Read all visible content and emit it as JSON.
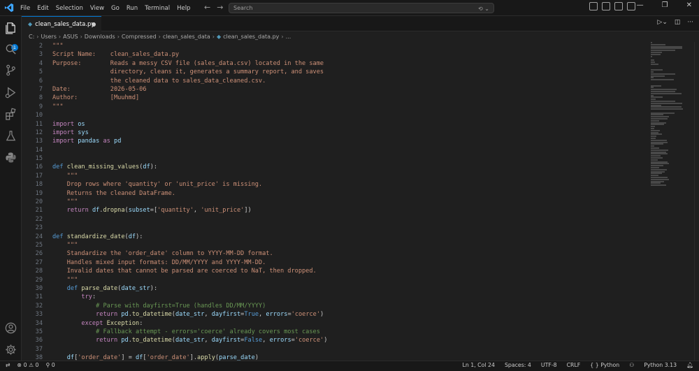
{
  "menu": [
    "File",
    "Edit",
    "Selection",
    "View",
    "Go",
    "Run",
    "Terminal",
    "Help"
  ],
  "search": {
    "placeholder": "Search"
  },
  "activity": {
    "badge": "1"
  },
  "tab": {
    "label": "clean_sales_data.py"
  },
  "breadcrumb": [
    "C:",
    "Users",
    "ASUS",
    "Downloads",
    "Compressed",
    "clean_sales_data",
    "clean_sales_data.py",
    "..."
  ],
  "code": [
    {
      "n": "2",
      "html": "<span class=\"doc\">\"\"\"</span>"
    },
    {
      "n": "3",
      "html": "<span class=\"doc\">Script Name:    clean_sales_data.py</span>"
    },
    {
      "n": "4",
      "html": "<span class=\"doc\">Purpose:        Reads a messy CSV file (sales_data.csv) located in the same</span>"
    },
    {
      "n": "5",
      "html": "<span class=\"doc\">                directory, cleans it, generates a summary report, and saves</span>"
    },
    {
      "n": "6",
      "html": "<span class=\"doc\">                the cleaned data to sales_data_cleaned.csv.</span>"
    },
    {
      "n": "7",
      "html": "<span class=\"doc\">Date:           2026-05-06</span>"
    },
    {
      "n": "8",
      "html": "<span class=\"doc\">Author:         [Muuhmd]</span>"
    },
    {
      "n": "9",
      "html": "<span class=\"doc\">\"\"\"</span>"
    },
    {
      "n": "10",
      "html": ""
    },
    {
      "n": "11",
      "html": "<span class=\"kw2\">import</span> <span class=\"prm\">os</span>"
    },
    {
      "n": "12",
      "html": "<span class=\"kw2\">import</span> <span class=\"prm\">sys</span>"
    },
    {
      "n": "13",
      "html": "<span class=\"kw2\">import</span> <span class=\"prm\">pandas</span> <span class=\"kw2\">as</span> <span class=\"prm\">pd</span>"
    },
    {
      "n": "14",
      "html": ""
    },
    {
      "n": "15",
      "html": ""
    },
    {
      "n": "16",
      "html": "<span class=\"kw\">def</span> <span class=\"fn\">clean_missing_values</span>(<span class=\"prm\">df</span>):"
    },
    {
      "n": "17",
      "html": "    <span class=\"doc\">\"\"\"</span>"
    },
    {
      "n": "18",
      "html": "    <span class=\"doc\">Drop rows where 'quantity' or 'unit_price' is missing.</span>"
    },
    {
      "n": "19",
      "html": "    <span class=\"doc\">Returns the cleaned DataFrame.</span>"
    },
    {
      "n": "20",
      "html": "    <span class=\"doc\">\"\"\"</span>"
    },
    {
      "n": "21",
      "html": "    <span class=\"kw2\">return</span> <span class=\"prm\">df</span>.<span class=\"fn\">dropna</span>(<span class=\"prm\">subset</span>=[<span class=\"str\">'quantity'</span>, <span class=\"str\">'unit_price'</span>])"
    },
    {
      "n": "22",
      "html": ""
    },
    {
      "n": "23",
      "html": ""
    },
    {
      "n": "24",
      "html": "<span class=\"kw\">def</span> <span class=\"fn\">standardize_date</span>(<span class=\"prm\">df</span>):"
    },
    {
      "n": "25",
      "html": "    <span class=\"doc\">\"\"\"</span>"
    },
    {
      "n": "26",
      "html": "    <span class=\"doc\">Standardize the 'order_date' column to YYYY-MM-DD format.</span>"
    },
    {
      "n": "27",
      "html": "    <span class=\"doc\">Handles mixed input formats: DD/MM/YYYY and YYYY-MM-DD.</span>"
    },
    {
      "n": "28",
      "html": "    <span class=\"doc\">Invalid dates that cannot be parsed are coerced to NaT, then dropped.</span>"
    },
    {
      "n": "29",
      "html": "    <span class=\"doc\">\"\"\"</span>"
    },
    {
      "n": "30",
      "html": "    <span class=\"kw\">def</span> <span class=\"fn\">parse_date</span>(<span class=\"prm\">date_str</span>):"
    },
    {
      "n": "31",
      "html": "        <span class=\"kw2\">try</span>:"
    },
    {
      "n": "32",
      "html": "            <span class=\"cm\"># Parse with dayfirst=True (handles DD/MM/YYYY)</span>"
    },
    {
      "n": "33",
      "html": "            <span class=\"kw2\">return</span> <span class=\"prm\">pd</span>.<span class=\"fn\">to_datetime</span>(<span class=\"prm\">date_str</span>, <span class=\"prm\">dayfirst</span>=<span class=\"kw\">True</span>, <span class=\"prm\">errors</span>=<span class=\"str\">'coerce'</span>)"
    },
    {
      "n": "34",
      "html": "        <span class=\"kw2\">except</span> <span class=\"fn\">Exception</span>:"
    },
    {
      "n": "35",
      "html": "            <span class=\"cm\"># Fallback attempt - errors='coerce' already covers most cases</span>"
    },
    {
      "n": "36",
      "html": "            <span class=\"kw2\">return</span> <span class=\"prm\">pd</span>.<span class=\"fn\">to_datetime</span>(<span class=\"prm\">date_str</span>, <span class=\"prm\">dayfirst</span>=<span class=\"kw\">False</span>, <span class=\"prm\">errors</span>=<span class=\"str\">'coerce'</span>)"
    },
    {
      "n": "37",
      "html": ""
    },
    {
      "n": "38",
      "html": "    <span class=\"prm\">df</span>[<span class=\"str\">'order_date'</span>] = <span class=\"prm\">df</span>[<span class=\"str\">'order_date'</span>].<span class=\"fn\">apply</span>(<span class=\"prm\">parse_date</span>)"
    }
  ],
  "status": {
    "errors": "0",
    "warnings": "0",
    "ports": "0",
    "position": "Ln 1, Col 24",
    "spaces": "Spaces: 4",
    "encoding": "UTF-8",
    "eol": "CRLF",
    "language": "Python",
    "interpreter": "Python 3.13"
  },
  "colors": {
    "accent": "#0078d4",
    "background": "#1f1f1f",
    "chrome": "#181818"
  }
}
